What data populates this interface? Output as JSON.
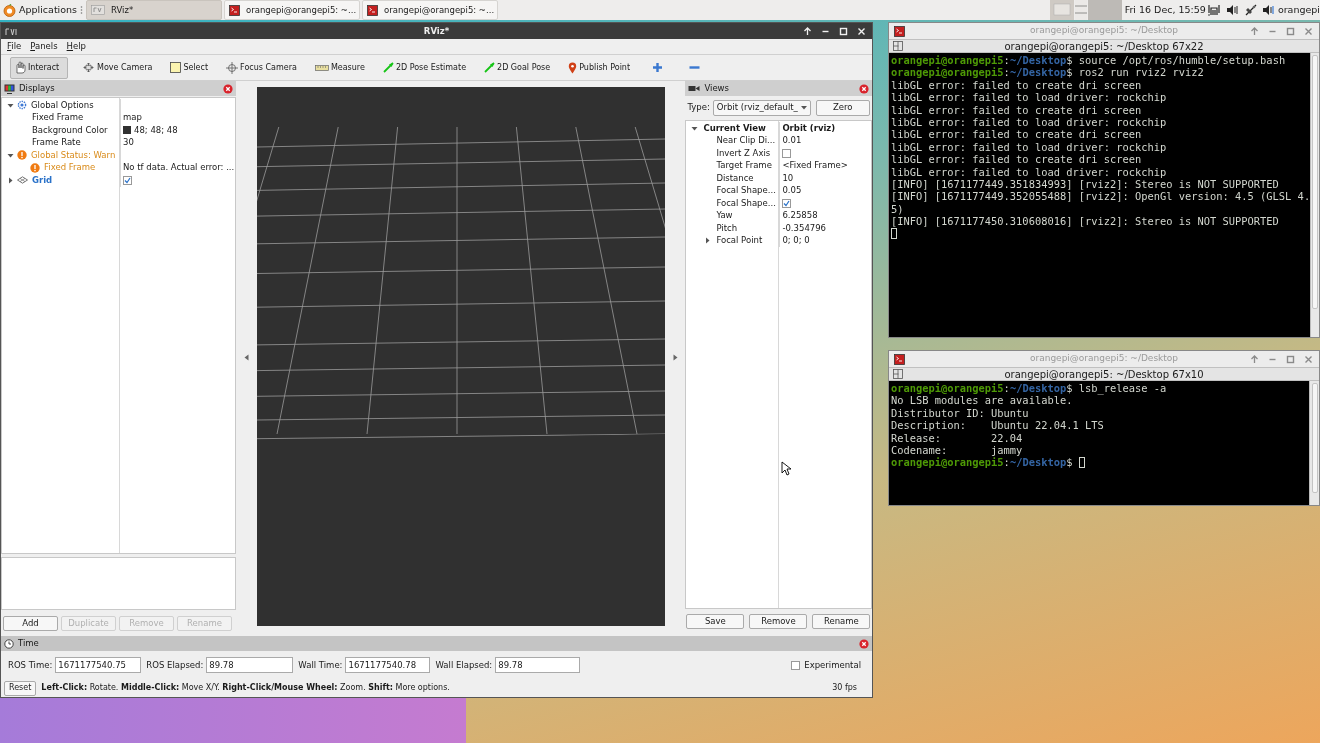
{
  "taskbar": {
    "menu_label": "Applications",
    "tasks": [
      {
        "kind": "rviz",
        "title": "RViz*",
        "selected": true
      },
      {
        "kind": "terminal",
        "title": "orangepi@orangepi5: ~...",
        "selected": false
      },
      {
        "kind": "terminal",
        "title": "orangepi@orangepi5: ~...",
        "selected": false
      }
    ],
    "clock": "Fri 16 Dec, 15:59",
    "user": "orangepi"
  },
  "rviz": {
    "title": "RViz*",
    "menu": [
      "File",
      "Panels",
      "Help"
    ],
    "tools": [
      {
        "kind": "interact",
        "label": "Interact",
        "selected": true
      },
      {
        "kind": "move",
        "label": "Move Camera",
        "selected": false
      },
      {
        "kind": "select",
        "label": "Select",
        "selected": false
      },
      {
        "kind": "focus",
        "label": "Focus Camera",
        "selected": false
      },
      {
        "kind": "measure",
        "label": "Measure",
        "selected": false
      },
      {
        "kind": "pose",
        "label": "2D Pose Estimate",
        "selected": false
      },
      {
        "kind": "goal",
        "label": "2D Goal Pose",
        "selected": false
      },
      {
        "kind": "point",
        "label": "Publish Point",
        "selected": false
      },
      {
        "kind": "add",
        "selected": false
      },
      {
        "kind": "remove",
        "selected": false
      }
    ],
    "displays": {
      "title": "Displays",
      "tree": [
        {
          "kind": "options",
          "label": "Global Options",
          "expanded": true,
          "children": [
            {
              "kind": "property",
              "label": "Fixed Frame",
              "value": "map"
            },
            {
              "kind": "property",
              "label": "Background Color",
              "color": "#303030",
              "value": "48; 48; 48"
            },
            {
              "kind": "property",
              "label": "Frame Rate",
              "value": "30"
            }
          ]
        },
        {
          "kind": "status",
          "label": "Global Status: Warn",
          "expanded": true,
          "children": [
            {
              "kind": "status",
              "label": "Fixed Frame",
              "value": "No tf data.  Actual error: ..."
            }
          ]
        },
        {
          "kind": "display",
          "label": "Grid",
          "expanded": false,
          "checked": true
        }
      ],
      "buttons": [
        {
          "label": "Add",
          "disabled": false
        },
        {
          "label": "Duplicate",
          "disabled": true
        },
        {
          "label": "Remove",
          "disabled": true
        },
        {
          "label": "Rename",
          "disabled": true
        }
      ]
    },
    "views": {
      "title": "Views",
      "type_label": "Type:",
      "type_value": "Orbit (rviz_default_",
      "zero_button": "Zero",
      "tree": [
        {
          "kind": "category",
          "label": "Current View",
          "value": "Orbit (rviz)",
          "expanded": true,
          "children": [
            {
              "kind": "property",
              "label": "Near Clip Di...",
              "value": "0.01"
            },
            {
              "kind": "property",
              "label": "Invert Z Axis",
              "checked": false
            },
            {
              "kind": "property",
              "label": "Target Frame",
              "value": "<Fixed Frame>"
            },
            {
              "kind": "property",
              "label": "Distance",
              "value": "10"
            },
            {
              "kind": "property",
              "label": "Focal Shape...",
              "value": "0.05"
            },
            {
              "kind": "property",
              "label": "Focal Shape...",
              "checked": true
            },
            {
              "kind": "property",
              "label": "Yaw",
              "value": "6.25858"
            },
            {
              "kind": "property",
              "label": "Pitch",
              "value": "-0.354796"
            },
            {
              "kind": "property",
              "label": "Focal Point",
              "value": "0; 0; 0",
              "expanded": false
            }
          ]
        }
      ],
      "buttons": [
        {
          "label": "Save",
          "disabled": false
        },
        {
          "label": "Remove",
          "disabled": false
        },
        {
          "label": "Rename",
          "disabled": false
        }
      ]
    },
    "time": {
      "title": "Time",
      "fields": [
        {
          "label": "ROS Time:",
          "value": "1671177540.75"
        },
        {
          "label": "ROS Elapsed:",
          "value": "89.78"
        },
        {
          "label": "Wall Time:",
          "value": "1671177540.78"
        },
        {
          "label": "Wall Elapsed:",
          "value": "89.78"
        }
      ],
      "experimental": {
        "label": "Experimental",
        "checked": false
      }
    },
    "reset_button": "Reset",
    "hint": "**Left-Click:** Rotate. **Middle-Click:** Move X/Y. **Right-Click/Mouse Wheel:** Zoom. **Shift:** More options.",
    "fps": "30 fps"
  },
  "terminals": [
    {
      "title": "orangepi@orangepi5: ~/Desktop",
      "header": "orangepi@orangepi5: ~/Desktop 67x22",
      "lines": [
        {
          "cursor": false,
          "parts": [
            {
              "kind": "user",
              "text": "orangepi@orangepi5"
            },
            {
              "kind": "plain",
              "text": ":"
            },
            {
              "kind": "path",
              "text": "~/Desktop"
            },
            {
              "kind": "plain",
              "text": "$ source /opt/ros/humble/setup.bash"
            }
          ]
        },
        {
          "cursor": false,
          "parts": [
            {
              "kind": "user",
              "text": "orangepi@orangepi5"
            },
            {
              "kind": "plain",
              "text": ":"
            },
            {
              "kind": "path",
              "text": "~/Desktop"
            },
            {
              "kind": "plain",
              "text": "$ ros2 run rviz2 rviz2"
            }
          ]
        },
        {
          "cursor": false,
          "parts": [
            {
              "kind": "plain",
              "text": "libGL error: failed to create dri screen"
            }
          ]
        },
        {
          "cursor": false,
          "parts": [
            {
              "kind": "plain",
              "text": "libGL error: failed to load driver: rockchip"
            }
          ]
        },
        {
          "cursor": false,
          "parts": [
            {
              "kind": "plain",
              "text": "libGL error: failed to create dri screen"
            }
          ]
        },
        {
          "cursor": false,
          "parts": [
            {
              "kind": "plain",
              "text": "libGL error: failed to load driver: rockchip"
            }
          ]
        },
        {
          "cursor": false,
          "parts": [
            {
              "kind": "plain",
              "text": "libGL error: failed to create dri screen"
            }
          ]
        },
        {
          "cursor": false,
          "parts": [
            {
              "kind": "plain",
              "text": "libGL error: failed to load driver: rockchip"
            }
          ]
        },
        {
          "cursor": false,
          "parts": [
            {
              "kind": "plain",
              "text": "libGL error: failed to create dri screen"
            }
          ]
        },
        {
          "cursor": false,
          "parts": [
            {
              "kind": "plain",
              "text": "libGL error: failed to load driver: rockchip"
            }
          ]
        },
        {
          "cursor": false,
          "parts": [
            {
              "kind": "plain",
              "text": "[INFO] [1671177449.351834993] [rviz2]: Stereo is NOT SUPPORTED"
            }
          ]
        },
        {
          "cursor": false,
          "parts": [
            {
              "kind": "plain",
              "text": "[INFO] [1671177449.352055488] [rviz2]: OpenGl version: 4.5 (GLSL 4."
            }
          ]
        },
        {
          "cursor": false,
          "parts": [
            {
              "kind": "plain",
              "text": "5)"
            }
          ]
        },
        {
          "cursor": false,
          "parts": [
            {
              "kind": "plain",
              "text": "[INFO] [1671177450.310608016] [rviz2]: Stereo is NOT SUPPORTED"
            }
          ]
        },
        {
          "cursor": true
        }
      ]
    },
    {
      "title": "orangepi@orangepi5: ~/Desktop",
      "header": "orangepi@orangepi5: ~/Desktop 67x10",
      "lines": [
        {
          "cursor": false,
          "parts": [
            {
              "kind": "user",
              "text": "orangepi@orangepi5"
            },
            {
              "kind": "plain",
              "text": ":"
            },
            {
              "kind": "path",
              "text": "~/Desktop"
            },
            {
              "kind": "plain",
              "text": "$ lsb_release -a"
            }
          ]
        },
        {
          "cursor": false,
          "parts": [
            {
              "kind": "plain",
              "text": "No LSB modules are available."
            }
          ]
        },
        {
          "cursor": false,
          "parts": [
            {
              "kind": "plain",
              "text": "Distributor ID: Ubuntu"
            }
          ]
        },
        {
          "cursor": false,
          "parts": [
            {
              "kind": "plain",
              "text": "Description:    Ubuntu 22.04.1 LTS"
            }
          ]
        },
        {
          "cursor": false,
          "parts": [
            {
              "kind": "plain",
              "text": "Release:        22.04"
            }
          ]
        },
        {
          "cursor": false,
          "parts": [
            {
              "kind": "plain",
              "text": "Codename:       jammy"
            }
          ]
        },
        {
          "cursor": true,
          "parts": [
            {
              "kind": "user",
              "text": "orangepi@orangepi5"
            },
            {
              "kind": "plain",
              "text": ":"
            },
            {
              "kind": "path",
              "text": "~/Desktop"
            },
            {
              "kind": "plain",
              "text": "$ "
            }
          ]
        }
      ]
    }
  ]
}
